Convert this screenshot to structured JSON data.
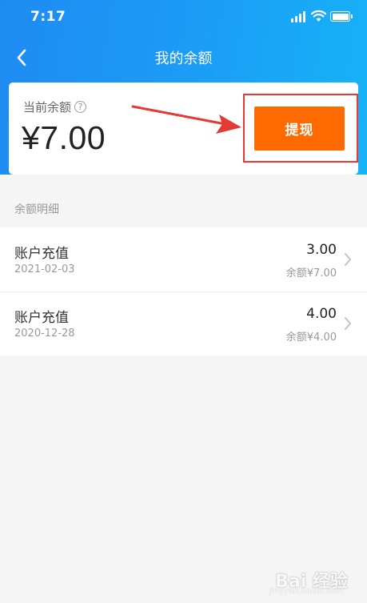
{
  "status_bar": {
    "time": "7:17"
  },
  "nav": {
    "title": "我的余额"
  },
  "balance_card": {
    "label": "当前余额",
    "help_glyph": "?",
    "amount": "¥7.00",
    "withdraw_label": "提现"
  },
  "details": {
    "section_title": "余额明细",
    "items": [
      {
        "title": "账户充值",
        "date": "2021-02-03",
        "amount": "3.00",
        "balance": "余额¥7.00"
      },
      {
        "title": "账户充值",
        "date": "2020-12-28",
        "amount": "4.00",
        "balance": "余额¥4.00"
      }
    ]
  },
  "watermark": {
    "text": "Bai 经验",
    "sub": "jingyan.baidu.com"
  },
  "colors": {
    "header_blue": "#1b9cf5",
    "withdraw_orange": "#ff6a00",
    "annotation_red": "#e53935"
  }
}
